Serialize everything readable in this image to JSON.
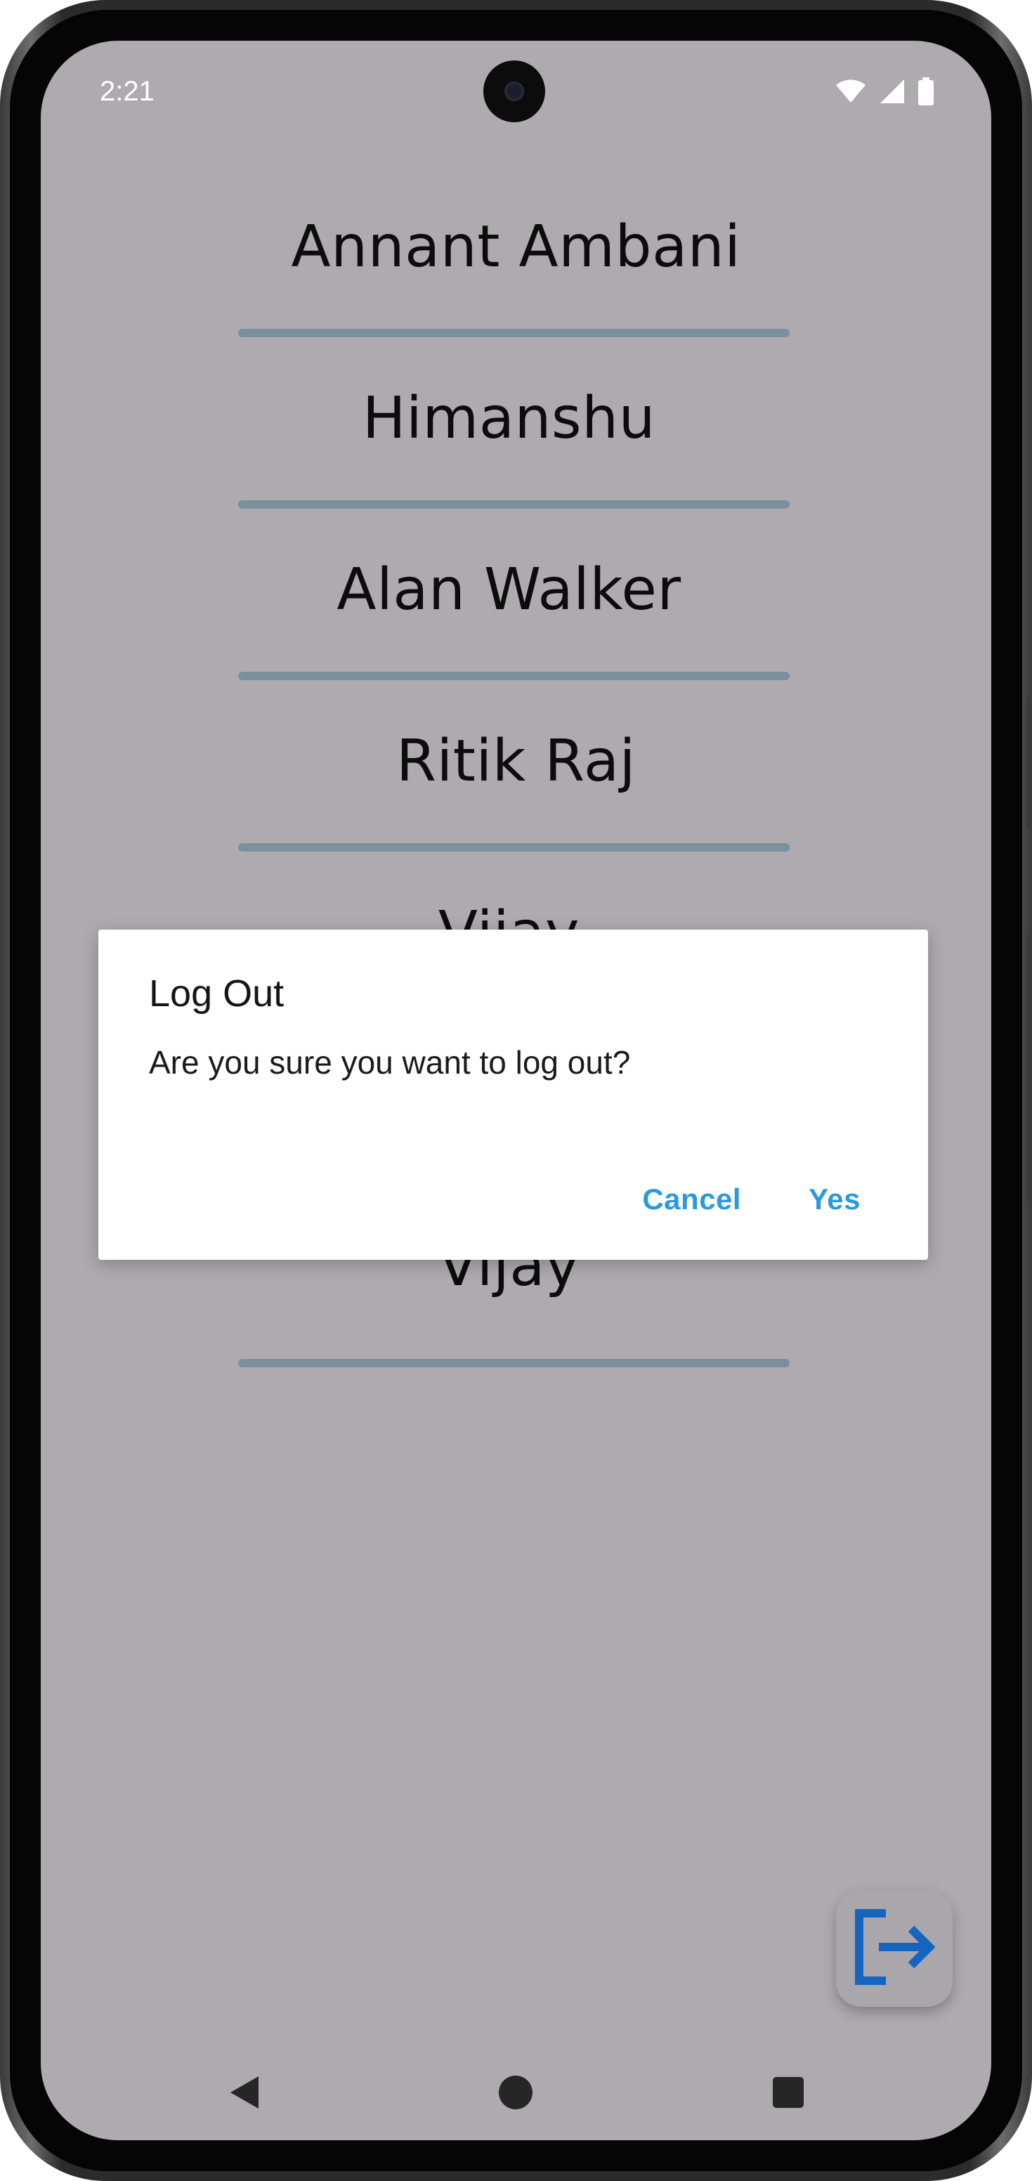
{
  "status_bar": {
    "time": "2:21",
    "icons": [
      "wifi-icon",
      "signal-icon",
      "battery-icon"
    ]
  },
  "contacts": [
    {
      "name": "Annant Ambani"
    },
    {
      "name": "Himanshu"
    },
    {
      "name": "Alan Walker"
    },
    {
      "name": "Ritik Raj"
    },
    {
      "name": "Vijay"
    },
    {
      "name": "Vijay"
    }
  ],
  "dialog": {
    "title": "Log Out",
    "message": "Are you sure you want to log out?",
    "cancel_label": "Cancel",
    "confirm_label": "Yes"
  },
  "fab": {
    "icon": "logout-icon"
  },
  "navigation_bar": {
    "back_icon": "back-icon",
    "home_icon": "home-icon",
    "recents_icon": "recents-icon"
  },
  "colors": {
    "screen_background": "#aeaaaf",
    "divider": "#7a909d",
    "dialog_action": "#2a9ae0",
    "logout_icon": "#1565c0"
  }
}
